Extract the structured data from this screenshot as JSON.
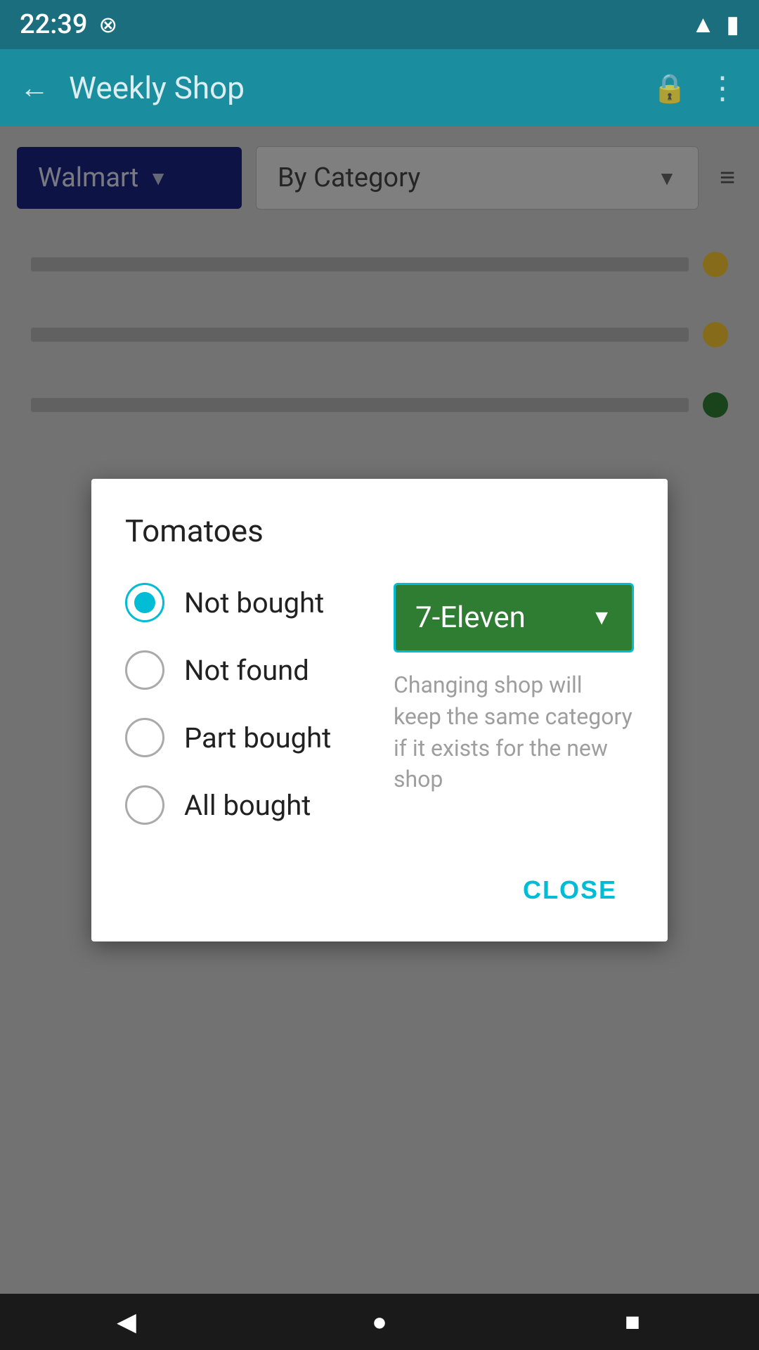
{
  "statusBar": {
    "time": "22:39",
    "signalIcon": "◤",
    "batteryIcon": "▮"
  },
  "toolbar": {
    "backIcon": "←",
    "title": "Weekly Shop",
    "lockIcon": "🔒",
    "moreIcon": "⋮"
  },
  "filters": {
    "storeLabel": "Walmart",
    "storeArrow": "▼",
    "categoryLabel": "By Category",
    "categoryArrow": "▼",
    "sortIcon": "≡"
  },
  "dialog": {
    "title": "Tomatoes",
    "options": [
      {
        "id": "not-bought",
        "label": "Not bought",
        "selected": true
      },
      {
        "id": "not-found",
        "label": "Not found",
        "selected": false
      },
      {
        "id": "part-bought",
        "label": "Part bought",
        "selected": false
      },
      {
        "id": "all-bought",
        "label": "All bought",
        "selected": false
      }
    ],
    "shopDropdown": {
      "label": "7-Eleven",
      "arrow": "▼"
    },
    "shopHint": "Changing shop will keep the same category if it exists for the new shop",
    "closeLabel": "CLOSE"
  },
  "navBar": {
    "backIcon": "◀",
    "homeIcon": "●",
    "recentIcon": "■"
  }
}
